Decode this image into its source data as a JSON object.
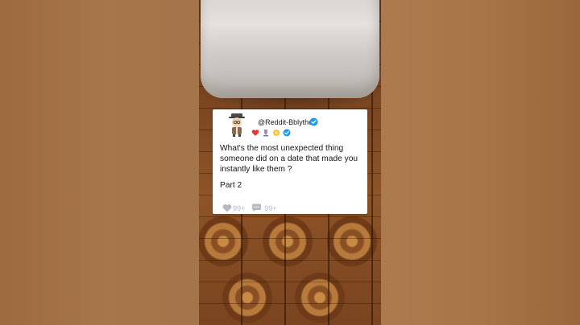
{
  "post": {
    "username": "@Reddit-Bblythe",
    "question": "What's the most unexpected thing someone did on a date that made you instantly like them ?",
    "part": "Part 2",
    "likes": "99+",
    "comments": "99+"
  },
  "icons": {
    "avatar": "cartoon-avatar-icon",
    "verified": "verified-check-icon",
    "like": "heart-icon",
    "comment": "speech-bubble-icon"
  },
  "colors": {
    "verified": "#1d9bf0",
    "stat": "#b4b9c4",
    "card": "#ffffff"
  }
}
